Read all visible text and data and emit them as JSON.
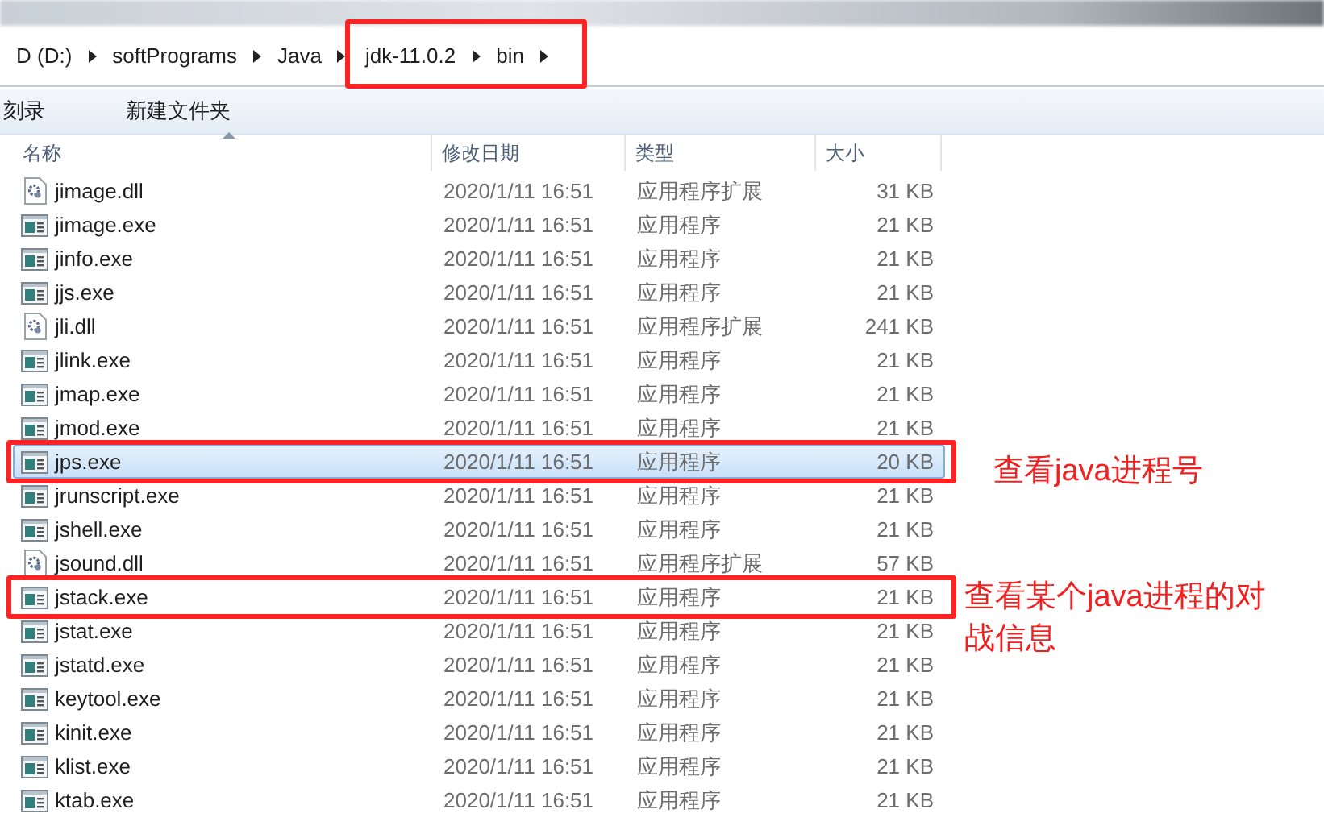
{
  "address_bar": {
    "crumbs": [
      {
        "label": "D (D:)",
        "highlighted": false
      },
      {
        "label": "softPrograms",
        "highlighted": false
      },
      {
        "label": "Java",
        "highlighted": false
      },
      {
        "label": "jdk-11.0.2",
        "highlighted": true
      },
      {
        "label": "bin",
        "highlighted": true
      }
    ]
  },
  "toolbar": [
    "刻录",
    "新建文件夹"
  ],
  "columns": [
    "名称",
    "修改日期",
    "类型",
    "大小"
  ],
  "rows": [
    {
      "name": "jimage.dll",
      "kind": "dll",
      "date": "2020/1/11 16:51",
      "type": "应用程序扩展",
      "size": "31 KB",
      "selected": false,
      "highlighted": false
    },
    {
      "name": "jimage.exe",
      "kind": "exe",
      "date": "2020/1/11 16:51",
      "type": "应用程序",
      "size": "21 KB",
      "selected": false,
      "highlighted": false
    },
    {
      "name": "jinfo.exe",
      "kind": "exe",
      "date": "2020/1/11 16:51",
      "type": "应用程序",
      "size": "21 KB",
      "selected": false,
      "highlighted": false
    },
    {
      "name": "jjs.exe",
      "kind": "exe",
      "date": "2020/1/11 16:51",
      "type": "应用程序",
      "size": "21 KB",
      "selected": false,
      "highlighted": false
    },
    {
      "name": "jli.dll",
      "kind": "dll",
      "date": "2020/1/11 16:51",
      "type": "应用程序扩展",
      "size": "241 KB",
      "selected": false,
      "highlighted": false
    },
    {
      "name": "jlink.exe",
      "kind": "exe",
      "date": "2020/1/11 16:51",
      "type": "应用程序",
      "size": "21 KB",
      "selected": false,
      "highlighted": false
    },
    {
      "name": "jmap.exe",
      "kind": "exe",
      "date": "2020/1/11 16:51",
      "type": "应用程序",
      "size": "21 KB",
      "selected": false,
      "highlighted": false
    },
    {
      "name": "jmod.exe",
      "kind": "exe",
      "date": "2020/1/11 16:51",
      "type": "应用程序",
      "size": "21 KB",
      "selected": false,
      "highlighted": false
    },
    {
      "name": "jps.exe",
      "kind": "exe",
      "date": "2020/1/11 16:51",
      "type": "应用程序",
      "size": "20 KB",
      "selected": true,
      "highlighted": true
    },
    {
      "name": "jrunscript.exe",
      "kind": "exe",
      "date": "2020/1/11 16:51",
      "type": "应用程序",
      "size": "21 KB",
      "selected": false,
      "highlighted": false
    },
    {
      "name": "jshell.exe",
      "kind": "exe",
      "date": "2020/1/11 16:51",
      "type": "应用程序",
      "size": "21 KB",
      "selected": false,
      "highlighted": false
    },
    {
      "name": "jsound.dll",
      "kind": "dll",
      "date": "2020/1/11 16:51",
      "type": "应用程序扩展",
      "size": "57 KB",
      "selected": false,
      "highlighted": false
    },
    {
      "name": "jstack.exe",
      "kind": "exe",
      "date": "2020/1/11 16:51",
      "type": "应用程序",
      "size": "21 KB",
      "selected": false,
      "highlighted": true
    },
    {
      "name": "jstat.exe",
      "kind": "exe",
      "date": "2020/1/11 16:51",
      "type": "应用程序",
      "size": "21 KB",
      "selected": false,
      "highlighted": false
    },
    {
      "name": "jstatd.exe",
      "kind": "exe",
      "date": "2020/1/11 16:51",
      "type": "应用程序",
      "size": "21 KB",
      "selected": false,
      "highlighted": false
    },
    {
      "name": "keytool.exe",
      "kind": "exe",
      "date": "2020/1/11 16:51",
      "type": "应用程序",
      "size": "21 KB",
      "selected": false,
      "highlighted": false
    },
    {
      "name": "kinit.exe",
      "kind": "exe",
      "date": "2020/1/11 16:51",
      "type": "应用程序",
      "size": "21 KB",
      "selected": false,
      "highlighted": false
    },
    {
      "name": "klist.exe",
      "kind": "exe",
      "date": "2020/1/11 16:51",
      "type": "应用程序",
      "size": "21 KB",
      "selected": false,
      "highlighted": false
    },
    {
      "name": "ktab.exe",
      "kind": "exe",
      "date": "2020/1/11 16:51",
      "type": "应用程序",
      "size": "21 KB",
      "selected": false,
      "highlighted": false
    }
  ],
  "annotations": [
    "查看java进程号",
    "查看某个java进程的对战信息"
  ]
}
